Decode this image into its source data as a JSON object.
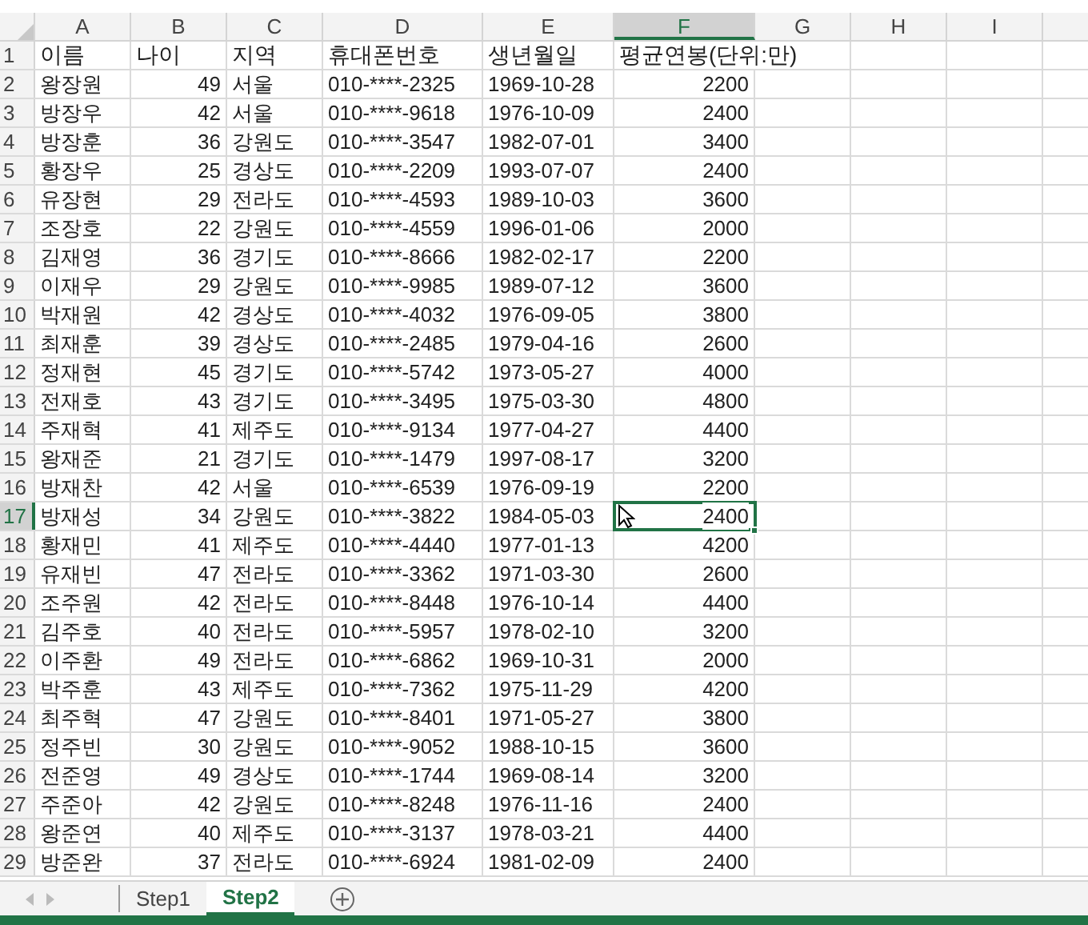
{
  "columns": [
    {
      "label": "A",
      "selected": false
    },
    {
      "label": "B",
      "selected": false
    },
    {
      "label": "C",
      "selected": false
    },
    {
      "label": "D",
      "selected": false
    },
    {
      "label": "E",
      "selected": false
    },
    {
      "label": "F",
      "selected": true
    },
    {
      "label": "G",
      "selected": false
    },
    {
      "label": "H",
      "selected": false
    },
    {
      "label": "I",
      "selected": false
    }
  ],
  "rows": [
    {
      "number": "1",
      "kind": "header",
      "selected": false,
      "cells": [
        "이름",
        "나이",
        "지역",
        "휴대폰번호",
        "생년월일",
        "평균연봉(단위:만)"
      ]
    },
    {
      "number": "2",
      "kind": "data",
      "selected": false,
      "cells": [
        "왕장원",
        "49",
        "서울",
        "010-****-2325",
        "1969-10-28",
        "2200"
      ]
    },
    {
      "number": "3",
      "kind": "data",
      "selected": false,
      "cells": [
        "방장우",
        "42",
        "서울",
        "010-****-9618",
        "1976-10-09",
        "2400"
      ]
    },
    {
      "number": "4",
      "kind": "data",
      "selected": false,
      "cells": [
        "방장훈",
        "36",
        "강원도",
        "010-****-3547",
        "1982-07-01",
        "3400"
      ]
    },
    {
      "number": "5",
      "kind": "data",
      "selected": false,
      "cells": [
        "황장우",
        "25",
        "경상도",
        "010-****-2209",
        "1993-07-07",
        "2400"
      ]
    },
    {
      "number": "6",
      "kind": "data",
      "selected": false,
      "cells": [
        "유장현",
        "29",
        "전라도",
        "010-****-4593",
        "1989-10-03",
        "3600"
      ]
    },
    {
      "number": "7",
      "kind": "data",
      "selected": false,
      "cells": [
        "조장호",
        "22",
        "강원도",
        "010-****-4559",
        "1996-01-06",
        "2000"
      ]
    },
    {
      "number": "8",
      "kind": "data",
      "selected": false,
      "cells": [
        "김재영",
        "36",
        "경기도",
        "010-****-8666",
        "1982-02-17",
        "2200"
      ]
    },
    {
      "number": "9",
      "kind": "data",
      "selected": false,
      "cells": [
        "이재우",
        "29",
        "강원도",
        "010-****-9985",
        "1989-07-12",
        "3600"
      ]
    },
    {
      "number": "10",
      "kind": "data",
      "selected": false,
      "cells": [
        "박재원",
        "42",
        "경상도",
        "010-****-4032",
        "1976-09-05",
        "3800"
      ]
    },
    {
      "number": "11",
      "kind": "data",
      "selected": false,
      "cells": [
        "최재훈",
        "39",
        "경상도",
        "010-****-2485",
        "1979-04-16",
        "2600"
      ]
    },
    {
      "number": "12",
      "kind": "data",
      "selected": false,
      "cells": [
        "정재현",
        "45",
        "경기도",
        "010-****-5742",
        "1973-05-27",
        "4000"
      ]
    },
    {
      "number": "13",
      "kind": "data",
      "selected": false,
      "cells": [
        "전재호",
        "43",
        "경기도",
        "010-****-3495",
        "1975-03-30",
        "4800"
      ]
    },
    {
      "number": "14",
      "kind": "data",
      "selected": false,
      "cells": [
        "주재혁",
        "41",
        "제주도",
        "010-****-9134",
        "1977-04-27",
        "4400"
      ]
    },
    {
      "number": "15",
      "kind": "data",
      "selected": false,
      "cells": [
        "왕재준",
        "21",
        "경기도",
        "010-****-1479",
        "1997-08-17",
        "3200"
      ]
    },
    {
      "number": "16",
      "kind": "data",
      "selected": false,
      "cells": [
        "방재찬",
        "42",
        "서울",
        "010-****-6539",
        "1976-09-19",
        "2200"
      ]
    },
    {
      "number": "17",
      "kind": "data",
      "selected": true,
      "cells": [
        "방재성",
        "34",
        "강원도",
        "010-****-3822",
        "1984-05-03",
        "2400"
      ]
    },
    {
      "number": "18",
      "kind": "data",
      "selected": false,
      "cells": [
        "황재민",
        "41",
        "제주도",
        "010-****-4440",
        "1977-01-13",
        "4200"
      ]
    },
    {
      "number": "19",
      "kind": "data",
      "selected": false,
      "cells": [
        "유재빈",
        "47",
        "전라도",
        "010-****-3362",
        "1971-03-30",
        "2600"
      ]
    },
    {
      "number": "20",
      "kind": "data",
      "selected": false,
      "cells": [
        "조주원",
        "42",
        "전라도",
        "010-****-8448",
        "1976-10-14",
        "4400"
      ]
    },
    {
      "number": "21",
      "kind": "data",
      "selected": false,
      "cells": [
        "김주호",
        "40",
        "전라도",
        "010-****-5957",
        "1978-02-10",
        "3200"
      ]
    },
    {
      "number": "22",
      "kind": "data",
      "selected": false,
      "cells": [
        "이주환",
        "49",
        "전라도",
        "010-****-6862",
        "1969-10-31",
        "2000"
      ]
    },
    {
      "number": "23",
      "kind": "data",
      "selected": false,
      "cells": [
        "박주훈",
        "43",
        "제주도",
        "010-****-7362",
        "1975-11-29",
        "4200"
      ]
    },
    {
      "number": "24",
      "kind": "data",
      "selected": false,
      "cells": [
        "최주혁",
        "47",
        "강원도",
        "010-****-8401",
        "1971-05-27",
        "3800"
      ]
    },
    {
      "number": "25",
      "kind": "data",
      "selected": false,
      "cells": [
        "정주빈",
        "30",
        "강원도",
        "010-****-9052",
        "1988-10-15",
        "3600"
      ]
    },
    {
      "number": "26",
      "kind": "data",
      "selected": false,
      "cells": [
        "전준영",
        "49",
        "경상도",
        "010-****-1744",
        "1969-08-14",
        "3200"
      ]
    },
    {
      "number": "27",
      "kind": "data",
      "selected": false,
      "cells": [
        "주준아",
        "42",
        "강원도",
        "010-****-8248",
        "1976-11-16",
        "2400"
      ]
    },
    {
      "number": "28",
      "kind": "data",
      "selected": false,
      "cells": [
        "왕준연",
        "40",
        "제주도",
        "010-****-3137",
        "1978-03-21",
        "4400"
      ]
    },
    {
      "number": "29",
      "kind": "data",
      "selected": false,
      "cells": [
        "방준완",
        "37",
        "전라도",
        "010-****-6924",
        "1981-02-09",
        "2400"
      ]
    }
  ],
  "sheets": [
    {
      "label": "Step1",
      "selected": false
    },
    {
      "label": "Step2",
      "selected": true
    }
  ]
}
